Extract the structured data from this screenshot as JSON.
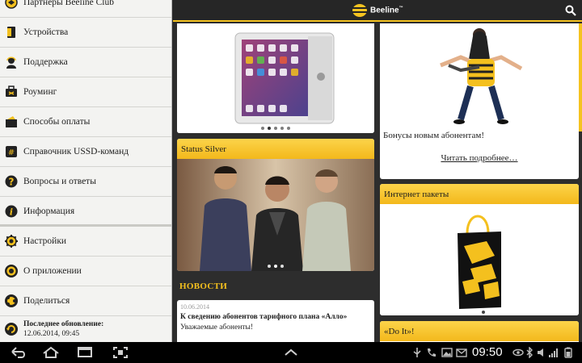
{
  "sidebar": {
    "items": [
      {
        "label": "Партнеры Beeline Club",
        "icon": "partners-icon"
      },
      {
        "label": "Устройства",
        "icon": "devices-icon"
      },
      {
        "label": "Поддержка",
        "icon": "support-icon"
      },
      {
        "label": "Роуминг",
        "icon": "roaming-icon"
      },
      {
        "label": "Способы оплаты",
        "icon": "payment-icon"
      },
      {
        "label": "Справочник USSD-команд",
        "icon": "ussd-icon"
      },
      {
        "label": "Вопросы и ответы",
        "icon": "faq-icon"
      },
      {
        "label": "Информация",
        "icon": "info-icon"
      },
      {
        "label": "Настройки",
        "icon": "settings-icon"
      },
      {
        "label": "О приложении",
        "icon": "about-icon"
      },
      {
        "label": "Поделиться",
        "icon": "share-icon"
      }
    ],
    "update_label": "Последнее обновление:",
    "update_time": "12.06.2014, 09:45"
  },
  "topbar": {
    "logo_text": "Beeline",
    "logo_mark": "™"
  },
  "cards": {
    "status_silver": {
      "title": "Status Silver"
    },
    "bonus": {
      "text": "Бонусы новым абонентам!",
      "link": "Читать подробнее…"
    },
    "internet": {
      "title": "Интернет пакеты"
    },
    "doit": {
      "title": "«Do It»!"
    }
  },
  "news": {
    "heading": "НОВОСТИ",
    "item": {
      "date": "10.06.2014",
      "title": "К сведению абонентов тарифного плана «Алло»",
      "excerpt": "Уважаемые абоненты!"
    }
  },
  "statusbar": {
    "time": "09:50"
  },
  "colors": {
    "accent": "#f5c320",
    "dark": "#262626",
    "nav": "#000000"
  }
}
